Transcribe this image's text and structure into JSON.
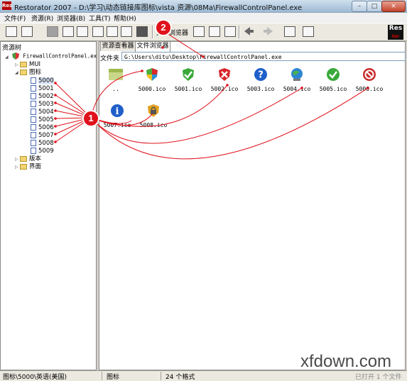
{
  "window": {
    "title": "Restorator 2007 - D:\\学习\\动态链接库图标\\vista 资源\\08Ma\\FirewallControlPanel.exe",
    "app_badge": "Res",
    "minimize": "–",
    "maximize": "□",
    "close": "×"
  },
  "menu": [
    "文件(F)",
    "资源(R)",
    "浏览器(B)",
    "工具(T)",
    "帮助(H)"
  ],
  "toolbar": {
    "file_browser_label": "文件浏览器",
    "logo_text_1": "Res",
    "logo_text_2": "tor"
  },
  "left_panel": {
    "header": "资源树",
    "root": "FirewallControlPanel.exe",
    "nodes": [
      {
        "label": "MUI"
      },
      {
        "label": "图标"
      },
      {
        "label": "5000"
      },
      {
        "label": "5001"
      },
      {
        "label": "5002"
      },
      {
        "label": "5003"
      },
      {
        "label": "5004"
      },
      {
        "label": "5005"
      },
      {
        "label": "5006"
      },
      {
        "label": "5007"
      },
      {
        "label": "5008"
      },
      {
        "label": "5009"
      },
      {
        "label": "版本"
      },
      {
        "label": "界面"
      }
    ]
  },
  "right_panel": {
    "tabs": [
      "资源查看器",
      "文件浏览器"
    ],
    "active_tab": "文件浏览器",
    "path_label": "文件夹",
    "path_value": "G:\\Users\\ditu\\Desktop\\FirewallControlPanel.exe",
    "files": [
      {
        "name": "..",
        "icon": "parent-folder-icon"
      },
      {
        "name": "5000.ico",
        "icon": "shield-color-icon"
      },
      {
        "name": "5001.ico",
        "icon": "green-check-shield-icon"
      },
      {
        "name": "5002.ico",
        "icon": "red-x-shield-icon"
      },
      {
        "name": "5003.ico",
        "icon": "help-question-icon"
      },
      {
        "name": "5004.ico",
        "icon": "globe-network-icon"
      },
      {
        "name": "5005.ico",
        "icon": "green-check-circle-icon"
      },
      {
        "name": "5006.ico",
        "icon": "blocked-circle-icon"
      },
      {
        "name": "5007.ico",
        "icon": "info-icon"
      },
      {
        "name": "5008.ico",
        "icon": "locked-shield-icon"
      }
    ]
  },
  "status": {
    "path": "图标\\5000\\英语(美国)",
    "category": "图标",
    "count": "24 个格式",
    "right": "已打开 1 个文件"
  },
  "annotations": {
    "badge_1": "1",
    "badge_2": "2",
    "color": "#e0111b"
  },
  "watermark": "xfdown.com"
}
